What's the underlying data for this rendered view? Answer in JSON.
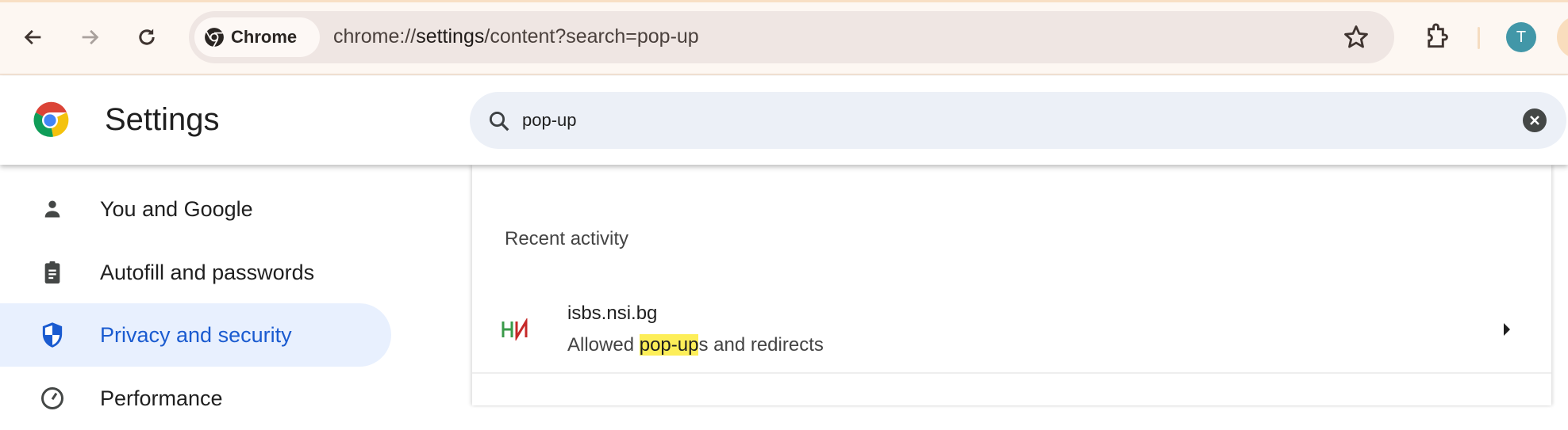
{
  "toolbar": {
    "back_icon": "arrow-left-icon",
    "forward_icon": "arrow-right-icon",
    "reload_icon": "reload-icon",
    "chip_label": "Chrome",
    "url_prefix": "chrome://",
    "url_host": "settings",
    "url_path": "/content?search=pop-up",
    "avatar_letter": "T",
    "avatar_color": "#4297a8"
  },
  "header": {
    "title": "Settings",
    "search_value": "pop-up"
  },
  "sidebar": {
    "items": [
      {
        "label": "You and Google",
        "icon": "person-icon"
      },
      {
        "label": "Autofill and passwords",
        "icon": "clipboard-icon"
      },
      {
        "label": "Privacy and security",
        "icon": "shield-icon",
        "active": true
      },
      {
        "label": "Performance",
        "icon": "speedometer-icon"
      }
    ]
  },
  "main": {
    "section_title": "Recent activity",
    "rows": [
      {
        "site": "isbs.nsi.bg",
        "desc_before": "Allowed ",
        "desc_highlight": "pop-up",
        "desc_after": "s and redirects"
      }
    ]
  },
  "colors": {
    "accent": "#1a5bd0",
    "active_bg": "#e8f0fe",
    "highlight": "#fdee58"
  }
}
